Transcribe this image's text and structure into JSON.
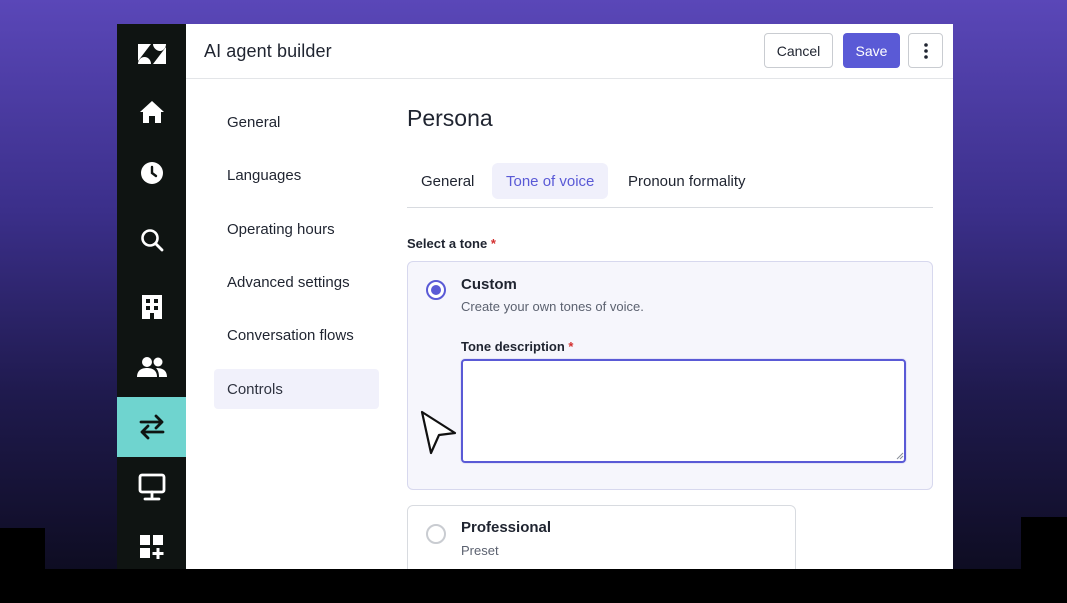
{
  "header": {
    "title": "AI agent builder",
    "cancel_label": "Cancel",
    "save_label": "Save"
  },
  "rail": {
    "items": [
      {
        "icon": "zendesk-logo-icon"
      },
      {
        "icon": "home-icon"
      },
      {
        "icon": "clock-icon"
      },
      {
        "icon": "search-icon"
      },
      {
        "icon": "building-icon"
      },
      {
        "icon": "users-icon"
      },
      {
        "icon": "transfer-arrows-icon",
        "active": true
      },
      {
        "icon": "monitor-icon"
      },
      {
        "icon": "apps-add-icon"
      }
    ]
  },
  "subnav": {
    "items": [
      {
        "label": "General"
      },
      {
        "label": "Languages"
      },
      {
        "label": "Operating hours"
      },
      {
        "label": "Advanced settings"
      },
      {
        "label": "Conversation flows"
      },
      {
        "label": "Controls",
        "active": true
      }
    ]
  },
  "main": {
    "title": "Persona",
    "tabs": [
      {
        "label": "General"
      },
      {
        "label": "Tone of voice",
        "active": true
      },
      {
        "label": "Pronoun formality"
      }
    ],
    "tone_label": "Select a tone",
    "required_mark": "*",
    "options": [
      {
        "title": "Custom",
        "subtitle": "Create your own tones of voice.",
        "selected": true
      },
      {
        "title": "Professional",
        "subtitle": "Preset",
        "selected": false
      }
    ],
    "tone_description_label": "Tone description",
    "tone_description_value": ""
  },
  "colors": {
    "accent": "#5a5ad6",
    "rail_bg": "#0f1412",
    "rail_active": "#6fd4cf",
    "required": "#d32f2f"
  }
}
